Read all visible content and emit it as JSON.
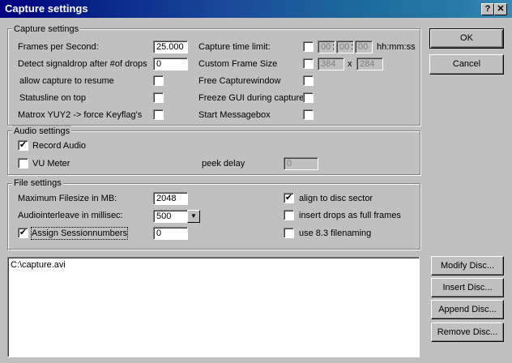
{
  "window": {
    "title": "Capture settings",
    "help_glyph": "?",
    "close_glyph": "✕"
  },
  "capture": {
    "group_label": "Capture settings",
    "fps_label": "Frames per Second:",
    "fps_value": "25.000",
    "signaldrop_label": "Detect signaldrop after #of drops",
    "signaldrop_value": "0",
    "resume_label": "allow capture to resume",
    "resume_checked": "",
    "statusline_label": "Statusline on top",
    "statusline_checked": "",
    "matrox_label": "Matrox YUY2 -> force Keyflag's",
    "matrox_checked": "",
    "timelimit_label": "Capture time limit:",
    "timelimit_checked": "",
    "time_h": "00",
    "time_m": "00",
    "time_s": "00",
    "time_sep": ":",
    "time_format": "hh:mm:ss",
    "framesize_label": "Custom Frame Size",
    "framesize_checked": "",
    "frame_w": "384",
    "frame_x": "x",
    "frame_h": "284",
    "freewin_label": "Free Capturewindow",
    "freewin_checked": "",
    "freeze_label": "Freeze GUI during capture",
    "freeze_checked": "",
    "msgbox_label": "Start Messagebox",
    "msgbox_checked": ""
  },
  "audio": {
    "group_label": "Audio settings",
    "record_label": "Record Audio",
    "record_checked": "✔",
    "vu_label": "VU Meter",
    "vu_checked": "",
    "peek_label": "peek delay",
    "peek_value": "0"
  },
  "file": {
    "group_label": "File settings",
    "maxsize_label": "Maximum Filesize in MB:",
    "maxsize_value": "2048",
    "interleave_label": "Audiointerleave in millisec:",
    "interleave_value": "500",
    "session_label": "Assign Sessionnumbers",
    "session_checked": "✔",
    "session_value": "0",
    "align_label": "align to disc sector",
    "align_checked": "✔",
    "drops_label": "insert drops as full frames",
    "drops_checked": "",
    "name83_label": "use 8.3 filenaming",
    "name83_checked": ""
  },
  "files_list": [
    "C:\\capture.avi"
  ],
  "buttons": {
    "ok": "OK",
    "cancel": "Cancel",
    "modify": "Modify Disc...",
    "insert": "Insert Disc...",
    "append": "Append Disc...",
    "remove": "Remove Disc..."
  }
}
